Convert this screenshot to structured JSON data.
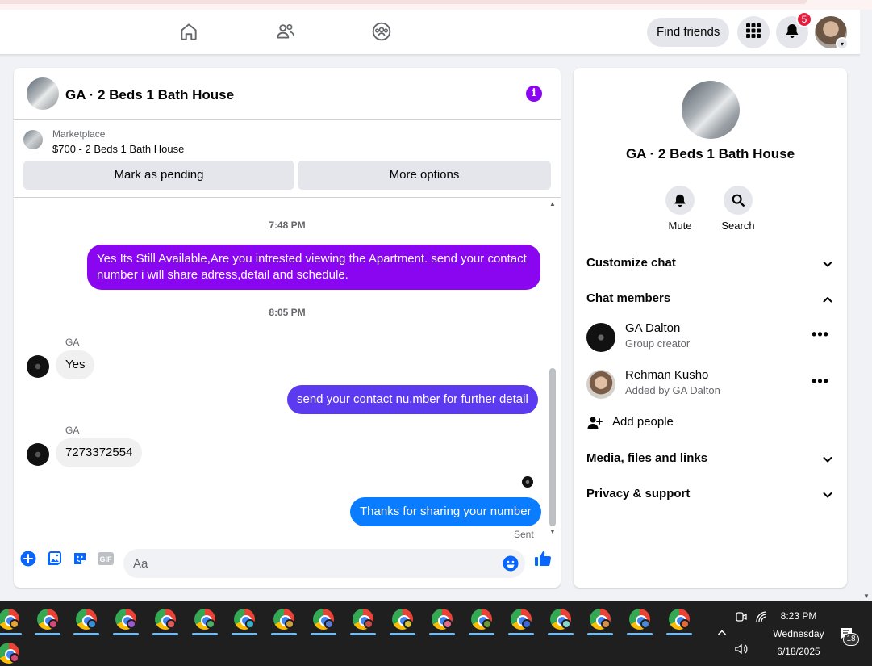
{
  "nav": {
    "find_friends": "Find friends",
    "notification_count": "5",
    "icons": [
      "home-icon",
      "friends-icon",
      "groups-icon",
      "menu-grid-icon",
      "bell-icon"
    ]
  },
  "chat": {
    "title": "GA · 2 Beds 1 Bath House",
    "listing": {
      "kicker": "Marketplace",
      "title": "$700 - 2 Beds 1 Bath House",
      "mark_pending": "Mark as pending",
      "more_options": "More options"
    },
    "timestamps": [
      "7:48 PM",
      "8:05 PM"
    ],
    "messages": [
      {
        "dir": "out",
        "text": "Yes Its Still Available,Are you intrested viewing the Apartment. send your contact number i will share adress,detail and schedule."
      },
      {
        "dir": "in",
        "sender": "GA",
        "text": "Yes"
      },
      {
        "dir": "out",
        "text": "send your contact nu.mber for further detail"
      },
      {
        "dir": "in",
        "sender": "GA",
        "text": "7273372554"
      },
      {
        "dir": "out",
        "text": "Thanks for sharing your number"
      }
    ],
    "sent_label": "Sent",
    "composer": {
      "placeholder": "Aa",
      "value": ""
    }
  },
  "side": {
    "title": "GA · 2 Beds 1 Bath House",
    "mute": "Mute",
    "search": "Search",
    "customize": "Customize chat",
    "members_header": "Chat members",
    "members": [
      {
        "name": "GA Dalton",
        "role": "Group creator"
      },
      {
        "name": "Rehman Kusho",
        "role": "Added by GA Dalton"
      }
    ],
    "add_people": "Add people",
    "media": "Media, files and links",
    "privacy": "Privacy & support"
  },
  "taskbar": {
    "time": "8:23 PM",
    "day": "Wednesday",
    "date": "6/18/2025",
    "notifications": "18"
  },
  "colors": {
    "purple": "#8a06f0",
    "indigo": "#5b3af0",
    "blue": "#0a7cff",
    "badge_red": "#e41e3f"
  }
}
